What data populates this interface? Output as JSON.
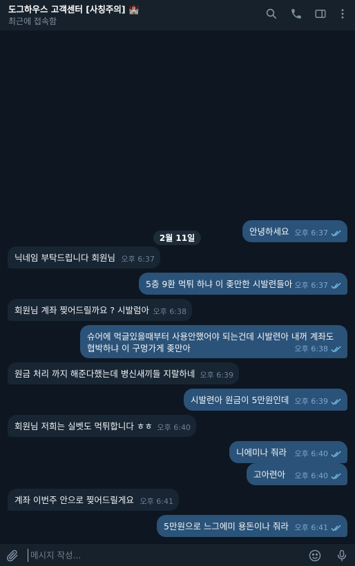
{
  "header": {
    "title": "도그하우스 고객센터 [사칭주의] 🏰",
    "status": "최근에 접속함",
    "icons": [
      "search-icon",
      "phone-icon",
      "sidebar-icon",
      "more-icon"
    ]
  },
  "date_separator": "2월 11일",
  "messages": [
    {
      "dir": "out",
      "text": "안녕하세요",
      "time": "오후 6:37"
    },
    {
      "dir": "in",
      "text": "닉네임 부탁드립니다 회원님",
      "time": "오후 6:37"
    },
    {
      "dir": "out",
      "text": "5층 9환 먹튀 하냐 이 좆만한 시발련들아",
      "time": "오후 6:37"
    },
    {
      "dir": "in",
      "text": "회원님 계좌 찢어드릴까요 ? 시발럼아",
      "time": "오후 6:38"
    },
    {
      "dir": "out",
      "text": "슈어에 먹글있을때부터 사용안했어야 되는건데 시발련아 내꺼 계좌도",
      "text2": "협박하냐 이 구멍가게 좆만아",
      "time": "오후 6:38"
    },
    {
      "dir": "in",
      "text": "원금 처리 까지 해준다했는데 병신새끼들 지랄하네",
      "time": "오후 6:39"
    },
    {
      "dir": "out",
      "text": "시발련아 원금이 5만원인데",
      "time": "오후 6:39"
    },
    {
      "dir": "in",
      "text": "회원님 저희는 실벳도 먹튀합니다 ㅎㅎ",
      "time": "오후 6:40"
    },
    {
      "dir": "out",
      "text": "니에미나 줘라",
      "time": "오후 6:40"
    },
    {
      "dir": "out",
      "text": "고아련아",
      "time": "오후 6:40"
    },
    {
      "dir": "in",
      "text": "계좌 이번주 안으로 찢어드릴게요",
      "time": "오후 6:41"
    },
    {
      "dir": "out",
      "text": "5만원으로 느그에미 용돈이나 줘라",
      "time": "오후 6:41"
    }
  ],
  "composer": {
    "placeholder": "메시지 작성...",
    "icons": [
      "attach-icon",
      "emoji-icon",
      "microphone-icon"
    ]
  },
  "colors": {
    "background": "#0e1621",
    "header": "#17212b",
    "incoming_bubble": "#182533",
    "outgoing_bubble": "#2b5278",
    "read_check": "#72bee8"
  }
}
